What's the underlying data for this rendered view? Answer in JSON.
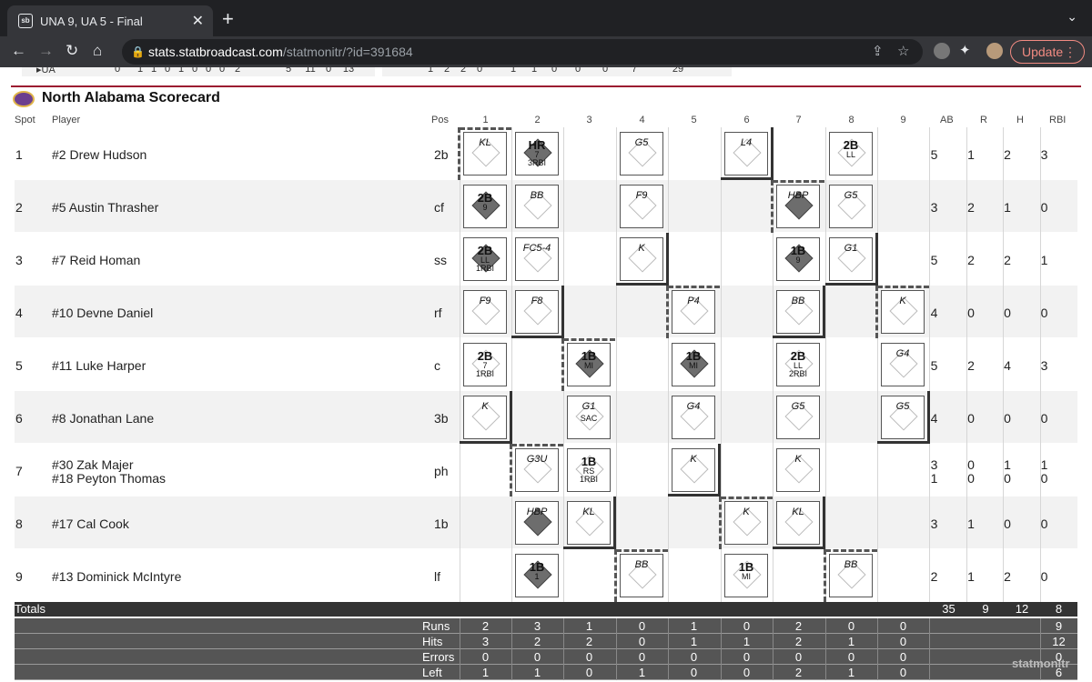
{
  "browser": {
    "tab_title": "UNA 9, UA 5 - Final",
    "favicon_text": "sb",
    "url_host": "stats.statbroadcast.com",
    "url_path": "/statmonitr/?id=391684",
    "update_label": "Update"
  },
  "linescore": {
    "team": "UA",
    "line1": [
      "0",
      "1",
      "1",
      "0",
      "1",
      "0",
      "0",
      "0",
      "2",
      "5",
      "11",
      "0",
      "13"
    ],
    "line2": [
      "1",
      "2",
      "2",
      "0",
      "1",
      "1",
      "0",
      "0",
      "0",
      "7",
      "29"
    ]
  },
  "scorecard": {
    "title": "North Alabama Scorecard",
    "headers": {
      "spot": "Spot",
      "player": "Player",
      "pos": "Pos",
      "ab": "AB",
      "r": "R",
      "h": "H",
      "rbi": "RBI"
    },
    "innings": [
      "1",
      "2",
      "3",
      "4",
      "5",
      "6",
      "7",
      "8",
      "9"
    ],
    "rows": [
      {
        "spot": "1",
        "players": [
          "#2 Drew Hudson"
        ],
        "pos": "2b",
        "ab": [
          "5"
        ],
        "r": [
          "1"
        ],
        "h": [
          "2"
        ],
        "rbi": [
          "3"
        ]
      },
      {
        "spot": "2",
        "players": [
          "#5 Austin Thrasher"
        ],
        "pos": "cf",
        "ab": [
          "3"
        ],
        "r": [
          "2"
        ],
        "h": [
          "1"
        ],
        "rbi": [
          "0"
        ]
      },
      {
        "spot": "3",
        "players": [
          "#7 Reid Homan"
        ],
        "pos": "ss",
        "ab": [
          "5"
        ],
        "r": [
          "2"
        ],
        "h": [
          "2"
        ],
        "rbi": [
          "1"
        ]
      },
      {
        "spot": "4",
        "players": [
          "#10 Devne Daniel"
        ],
        "pos": "rf",
        "ab": [
          "4"
        ],
        "r": [
          "0"
        ],
        "h": [
          "0"
        ],
        "rbi": [
          "0"
        ]
      },
      {
        "spot": "5",
        "players": [
          "#11 Luke Harper"
        ],
        "pos": "c",
        "ab": [
          "5"
        ],
        "r": [
          "2"
        ],
        "h": [
          "4"
        ],
        "rbi": [
          "3"
        ]
      },
      {
        "spot": "6",
        "players": [
          "#8 Jonathan Lane"
        ],
        "pos": "3b",
        "ab": [
          "4"
        ],
        "r": [
          "0"
        ],
        "h": [
          "0"
        ],
        "rbi": [
          "0"
        ]
      },
      {
        "spot": "7",
        "players": [
          "#30 Zak Majer",
          "#18 Peyton Thomas"
        ],
        "pos": "ph",
        "ab": [
          "3",
          "1"
        ],
        "r": [
          "0",
          "0"
        ],
        "h": [
          "1",
          "0"
        ],
        "rbi": [
          "1",
          "0"
        ]
      },
      {
        "spot": "8",
        "players": [
          "#17 Cal Cook"
        ],
        "pos": "1b",
        "ab": [
          "3"
        ],
        "r": [
          "1"
        ],
        "h": [
          "0"
        ],
        "rbi": [
          "0"
        ]
      },
      {
        "spot": "9",
        "players": [
          "#13 Dominick McIntyre"
        ],
        "pos": "lf",
        "ab": [
          "2"
        ],
        "r": [
          "1"
        ],
        "h": [
          "2"
        ],
        "rbi": [
          "0"
        ]
      }
    ],
    "atbats": [
      {
        "row": 0,
        "inn": 0,
        "r1": "KL"
      },
      {
        "row": 0,
        "inn": 1,
        "r1": "HR",
        "r2": "7",
        "r3": "3RBI",
        "big": true,
        "on": true
      },
      {
        "row": 0,
        "inn": 3,
        "r1": "G5"
      },
      {
        "row": 0,
        "inn": 5,
        "r1": "L4"
      },
      {
        "row": 0,
        "inn": 7,
        "r1": "2B",
        "r2": "LL",
        "big": true
      },
      {
        "row": 1,
        "inn": 0,
        "r1": "2B",
        "r2": "9",
        "big": true,
        "on": true
      },
      {
        "row": 1,
        "inn": 1,
        "r1": "BB"
      },
      {
        "row": 1,
        "inn": 3,
        "r1": "F9"
      },
      {
        "row": 1,
        "inn": 6,
        "r1": "HBP",
        "on": true
      },
      {
        "row": 1,
        "inn": 7,
        "r1": "G5"
      },
      {
        "row": 2,
        "inn": 0,
        "r1": "2B",
        "r2": "LL",
        "r3": "1RBI",
        "big": true,
        "on": true
      },
      {
        "row": 2,
        "inn": 1,
        "r1": "FC5-4"
      },
      {
        "row": 2,
        "inn": 3,
        "r1": "K"
      },
      {
        "row": 2,
        "inn": 6,
        "r1": "1B",
        "r2": "9",
        "big": true,
        "on": true
      },
      {
        "row": 2,
        "inn": 7,
        "r1": "G1"
      },
      {
        "row": 3,
        "inn": 0,
        "r1": "F9"
      },
      {
        "row": 3,
        "inn": 1,
        "r1": "F8"
      },
      {
        "row": 3,
        "inn": 4,
        "r1": "P4"
      },
      {
        "row": 3,
        "inn": 6,
        "r1": "BB"
      },
      {
        "row": 3,
        "inn": 8,
        "r1": "K"
      },
      {
        "row": 4,
        "inn": 0,
        "r1": "2B",
        "r2": "7",
        "r3": "1RBI",
        "big": true
      },
      {
        "row": 4,
        "inn": 2,
        "r1": "1B",
        "r2": "MI",
        "big": true,
        "on": true
      },
      {
        "row": 4,
        "inn": 4,
        "r1": "1B",
        "r2": "MI",
        "big": true,
        "on": true
      },
      {
        "row": 4,
        "inn": 6,
        "r1": "2B",
        "r2": "LL",
        "r3": "2RBI",
        "big": true
      },
      {
        "row": 4,
        "inn": 8,
        "r1": "G4"
      },
      {
        "row": 5,
        "inn": 0,
        "r1": "K"
      },
      {
        "row": 5,
        "inn": 2,
        "r1": "G1",
        "r2": "SAC"
      },
      {
        "row": 5,
        "inn": 4,
        "r1": "G4"
      },
      {
        "row": 5,
        "inn": 6,
        "r1": "G5"
      },
      {
        "row": 5,
        "inn": 8,
        "r1": "G5"
      },
      {
        "row": 6,
        "inn": 1,
        "r1": "G3U"
      },
      {
        "row": 6,
        "inn": 2,
        "r1": "1B",
        "r2": "RS",
        "r3": "1RBI",
        "big": true
      },
      {
        "row": 6,
        "inn": 4,
        "r1": "K"
      },
      {
        "row": 6,
        "inn": 6,
        "r1": "K"
      },
      {
        "row": 7,
        "inn": 1,
        "r1": "HBP",
        "on": true
      },
      {
        "row": 7,
        "inn": 2,
        "r1": "KL"
      },
      {
        "row": 7,
        "inn": 5,
        "r1": "K"
      },
      {
        "row": 7,
        "inn": 6,
        "r1": "KL"
      },
      {
        "row": 8,
        "inn": 1,
        "r1": "1B",
        "r2": "1",
        "big": true,
        "on": true
      },
      {
        "row": 8,
        "inn": 3,
        "r1": "BB"
      },
      {
        "row": 8,
        "inn": 5,
        "r1": "1B",
        "r2": "MI",
        "big": true
      },
      {
        "row": 8,
        "inn": 7,
        "r1": "BB"
      }
    ],
    "totals": {
      "label": "Totals",
      "ab": "35",
      "r": "9",
      "h": "12",
      "rbi": "8"
    },
    "footer": [
      {
        "label": "Runs",
        "values": [
          "2",
          "3",
          "1",
          "0",
          "1",
          "0",
          "2",
          "0",
          "0"
        ],
        "total": "9"
      },
      {
        "label": "Hits",
        "values": [
          "3",
          "2",
          "2",
          "0",
          "1",
          "1",
          "2",
          "1",
          "0"
        ],
        "total": "12"
      },
      {
        "label": "Errors",
        "values": [
          "0",
          "0",
          "0",
          "0",
          "0",
          "0",
          "0",
          "0",
          "0"
        ],
        "total": "0"
      },
      {
        "label": "Left",
        "values": [
          "1",
          "1",
          "0",
          "1",
          "0",
          "0",
          "2",
          "1",
          "0"
        ],
        "total": "6"
      }
    ],
    "watermark": "statmonitr"
  }
}
